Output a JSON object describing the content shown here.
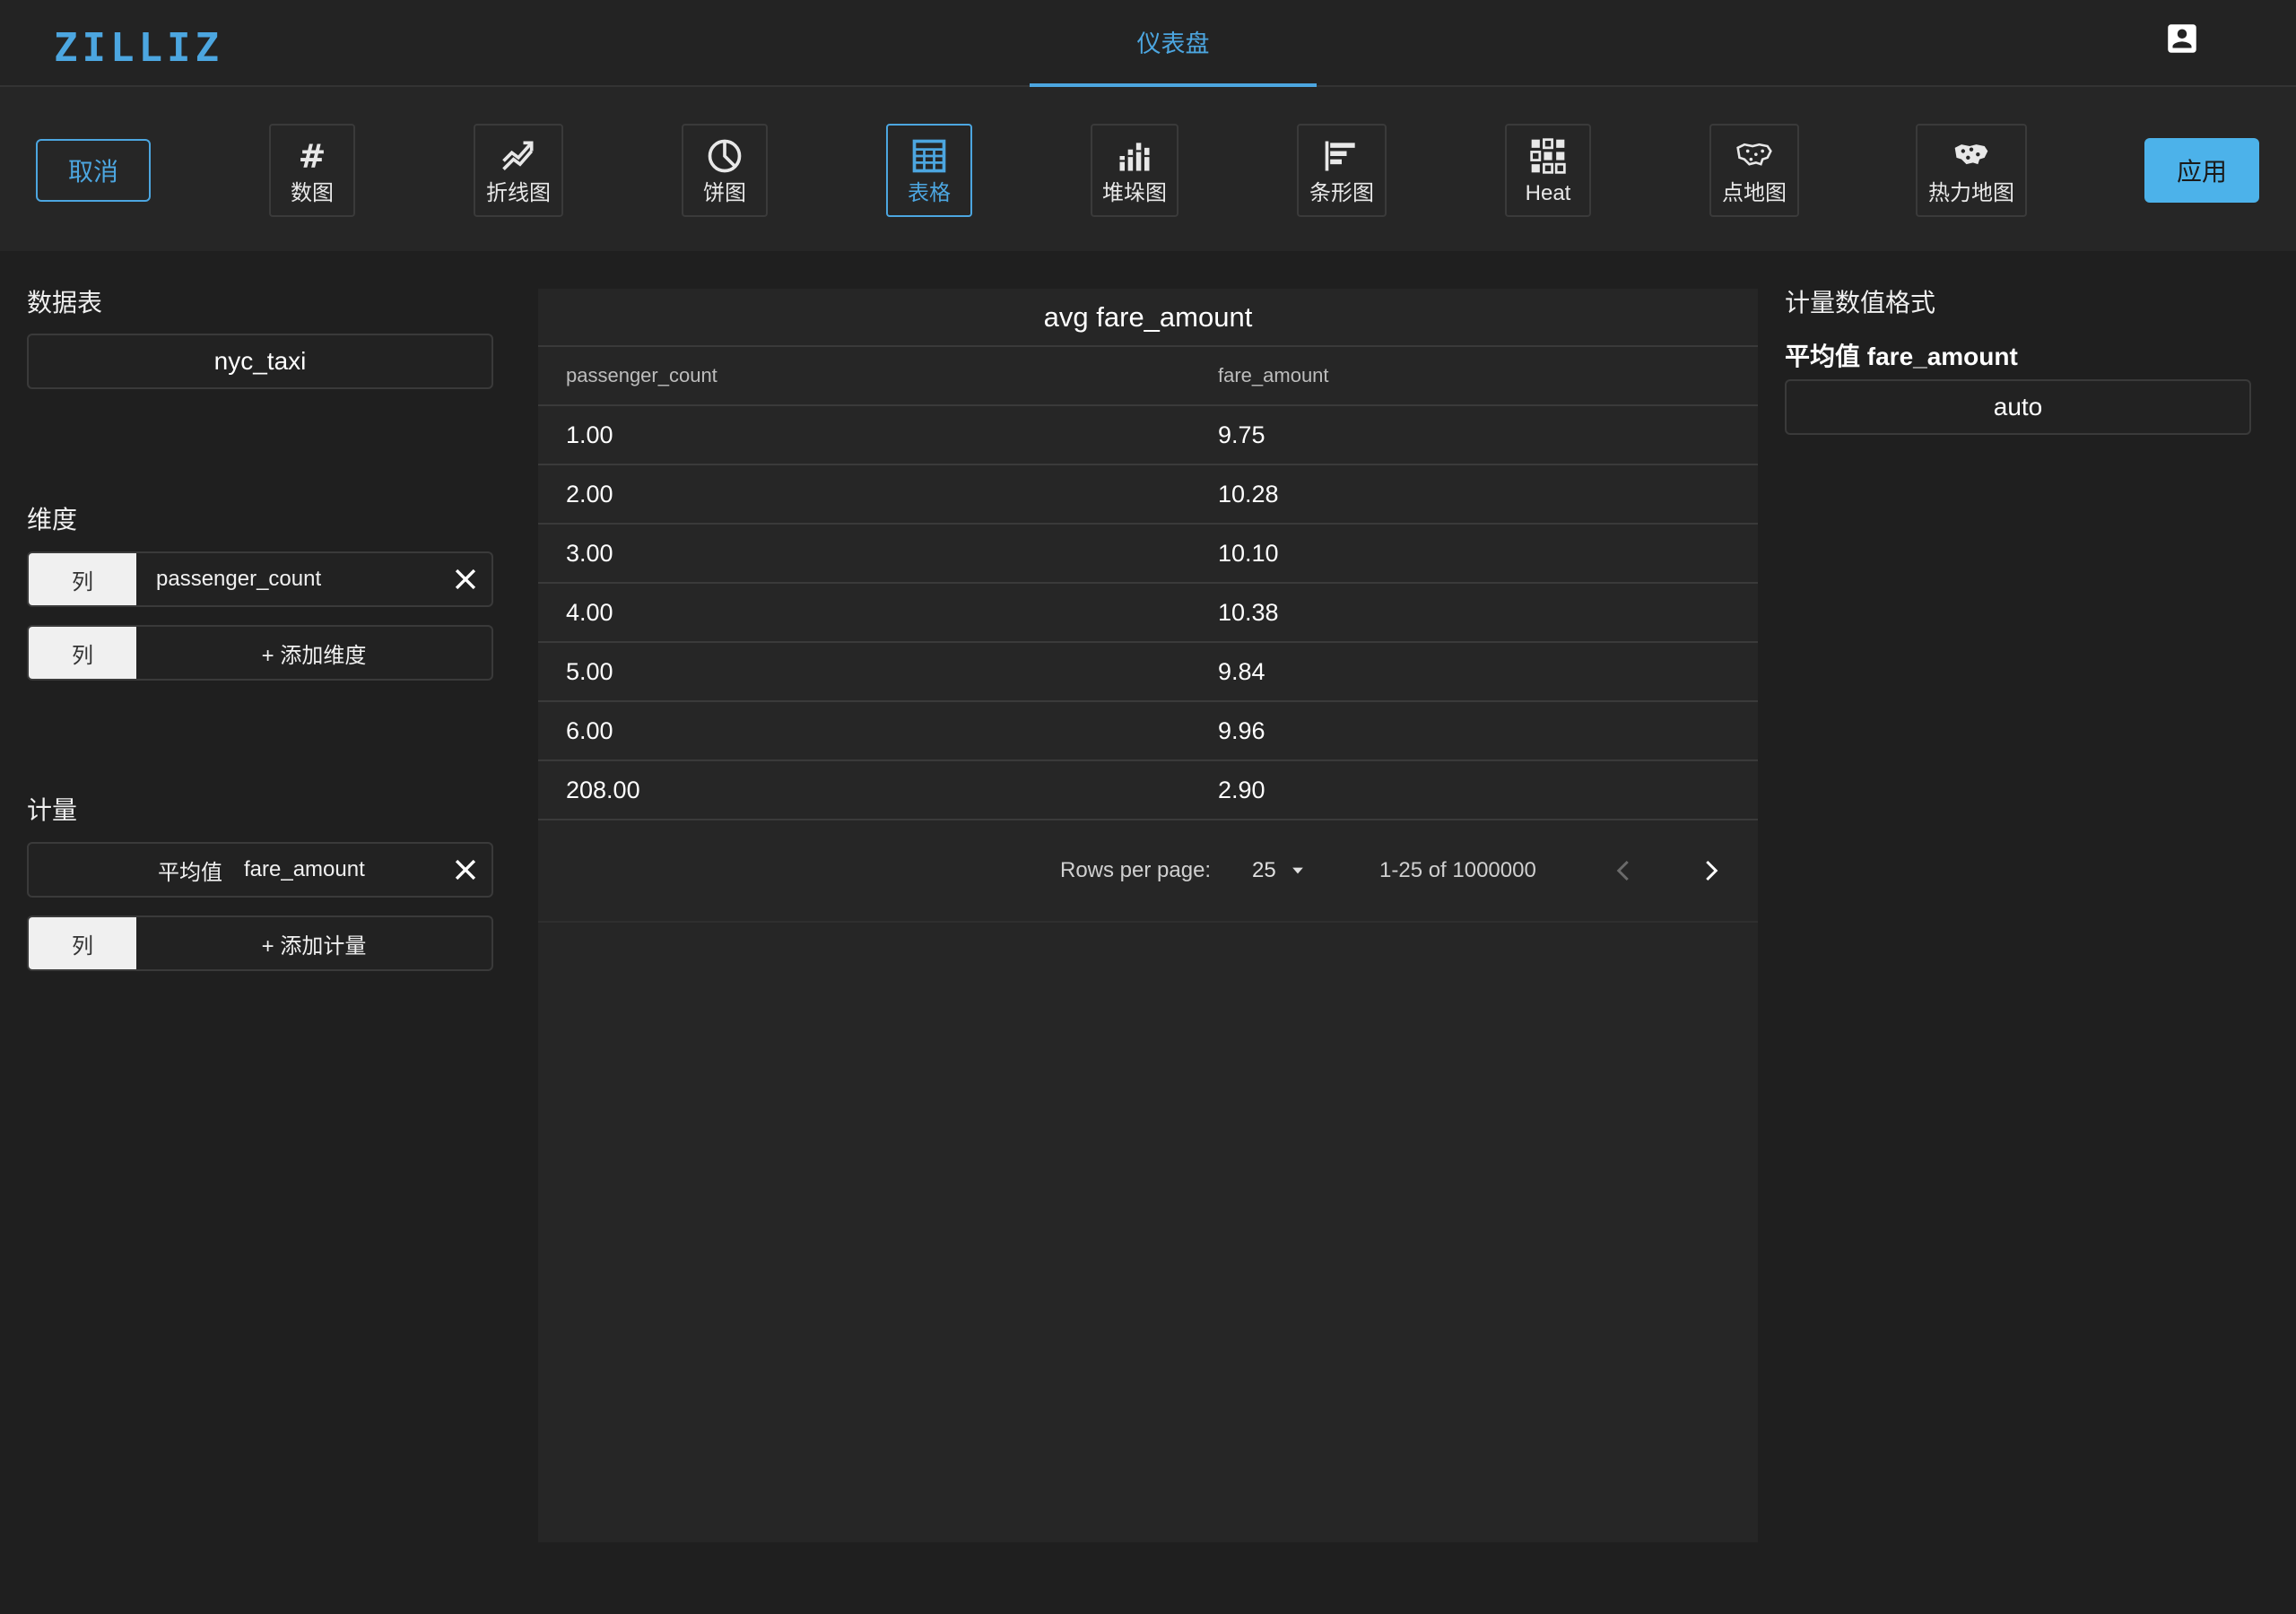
{
  "header": {
    "logo": "ZILLIZ",
    "tab": "仪表盘",
    "account_icon": "account-box-icon"
  },
  "toolbar": {
    "cancel": "取消",
    "apply": "应用",
    "chart_types": [
      {
        "label": "数图",
        "icon": "hash-icon"
      },
      {
        "label": "折线图",
        "icon": "line-chart-icon"
      },
      {
        "label": "饼图",
        "icon": "pie-chart-icon"
      },
      {
        "label": "表格",
        "icon": "table-icon",
        "active": true
      },
      {
        "label": "堆垛图",
        "icon": "stacked-bar-icon"
      },
      {
        "label": "条形图",
        "icon": "bar-chart-icon"
      },
      {
        "label": "Heat",
        "icon": "heat-grid-icon"
      },
      {
        "label": "点地图",
        "icon": "point-map-icon"
      },
      {
        "label": "热力地图",
        "icon": "heat-map-icon"
      }
    ]
  },
  "left": {
    "datasource_label": "数据表",
    "datasource_value": "nyc_taxi",
    "dimension_label": "维度",
    "dimension_chip": "列",
    "dimension_value": "passenger_count",
    "add_dimension_chip": "列",
    "add_dimension": "+ 添加维度",
    "measure_label": "计量",
    "measure_agg": "平均值",
    "measure_value": "fare_amount",
    "add_measure_chip": "列",
    "add_measure": "+ 添加计量"
  },
  "table": {
    "title": "avg fare_amount",
    "columns": [
      "passenger_count",
      "fare_amount"
    ],
    "rows": [
      [
        "1.00",
        "9.75"
      ],
      [
        "2.00",
        "10.28"
      ],
      [
        "3.00",
        "10.10"
      ],
      [
        "4.00",
        "10.38"
      ],
      [
        "5.00",
        "9.84"
      ],
      [
        "6.00",
        "9.96"
      ],
      [
        "208.00",
        "2.90"
      ]
    ],
    "rows_per_page_label": "Rows per page:",
    "rows_per_page": "25",
    "range": "1-25 of 1000000"
  },
  "right": {
    "format_label": "计量数值格式",
    "measure_name": "平均值 fare_amount",
    "format_value": "auto"
  },
  "colors": {
    "accent": "#4ca6e0",
    "background": "#1f1f1f",
    "panel": "#262626"
  }
}
